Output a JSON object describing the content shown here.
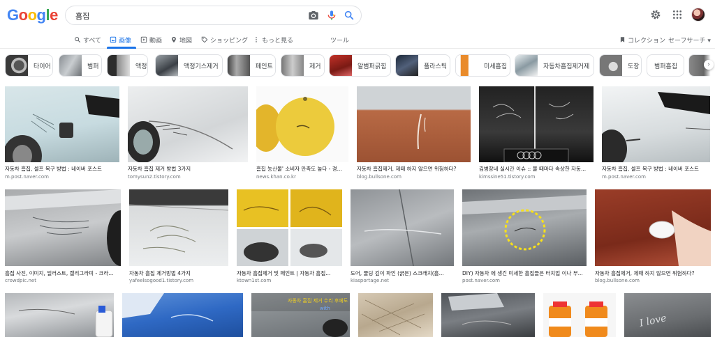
{
  "header": {
    "logo_letters": [
      {
        "ch": "G",
        "color": "#4285f4"
      },
      {
        "ch": "o",
        "color": "#ea4335"
      },
      {
        "ch": "o",
        "color": "#fbbc05"
      },
      {
        "ch": "g",
        "color": "#4285f4"
      },
      {
        "ch": "l",
        "color": "#34a853"
      },
      {
        "ch": "e",
        "color": "#ea4335"
      }
    ],
    "query": "흠집",
    "icons": [
      "camera-icon",
      "microphone-icon",
      "search-icon",
      "gear-icon",
      "apps-grid-icon",
      "avatar"
    ]
  },
  "tabs": [
    {
      "label": "すべて",
      "icon": "search-icon"
    },
    {
      "label": "画像",
      "icon": "image-icon",
      "active": true
    },
    {
      "label": "動画",
      "icon": "play-icon"
    },
    {
      "label": "地図",
      "icon": "map-pin-icon"
    },
    {
      "label": "ショッピング",
      "icon": "tag-icon"
    },
    {
      "label": "もっと見る",
      "icon": "more-vertical-icon"
    },
    {
      "label": "ツール",
      "icon": ""
    }
  ],
  "tabs_right": [
    {
      "label": "コレクション",
      "icon": "bookmark-icon"
    },
    {
      "label": "セーフサーチ ▾",
      "icon": ""
    }
  ],
  "chips": [
    {
      "label": "타이어"
    },
    {
      "label": "범퍼"
    },
    {
      "label": "액정"
    },
    {
      "label": "액정기스제거"
    },
    {
      "label": "페인트"
    },
    {
      "label": "제거"
    },
    {
      "label": "알범퍼긁힘"
    },
    {
      "label": "플라스틱"
    },
    {
      "label": "미세흠집"
    },
    {
      "label": "자동차흠집제거제"
    },
    {
      "label": "도장"
    },
    {
      "label": "범퍼흠집"
    }
  ],
  "results_row1": [
    {
      "title": "자동차 흠집, 셀프 복구 방법 : 네이버 포스트",
      "source": "m.post.naver.com"
    },
    {
      "title": "자동차 흠집 제거 방법 3가지",
      "source": "tomysun2.tistory.com"
    },
    {
      "title": "흠집 농산물' 소비자 만족도 높다 - 경...",
      "source": "news.khan.co.kr"
    },
    {
      "title": "자동차 흠집제거, 제때 하지 않으면 위험하다?",
      "source": "blog.bullsone.com"
    },
    {
      "title": "김병장네 실시간 이슈 :: 볼 때마다 속상한 자동...",
      "source": "kimssine51.tistory.com"
    },
    {
      "title": "자동차 흠집, 셀프 복구 방법 : 네이버 포스트",
      "source": "m.post.naver.com"
    }
  ],
  "results_row2": [
    {
      "title": "흠집 사진, 이미지, 일러스트, 캘리그라피 - 크라...",
      "source": "crowdpic.net"
    },
    {
      "title": "자동차 흠집 제거방법 4가지",
      "source": "yafeelsogood1.tistory.com"
    },
    {
      "title": "자동차 흠집제거 및 페인트 | 자동차 흠집...",
      "source": "ktown1st.com"
    },
    {
      "title": "도어, 물딩 깊이 파인 (굵은) 스크래치(흠...",
      "source": "kiasportage.net"
    },
    {
      "title": "DIY) 자동차 에 생긴 미세한 흠집들은 터치업 이나 부...",
      "source": "post.naver.com"
    },
    {
      "title": "자동차 흠집제거, 제때 하지 않으면 위험하다?",
      "source": "blog.bullsone.com"
    }
  ],
  "row3_text": [
    "자동차 흠집 제거 수리 후에도",
    "with",
    "I love"
  ],
  "colors": {
    "accent": "#1a73e8",
    "muted": "#70757a"
  }
}
